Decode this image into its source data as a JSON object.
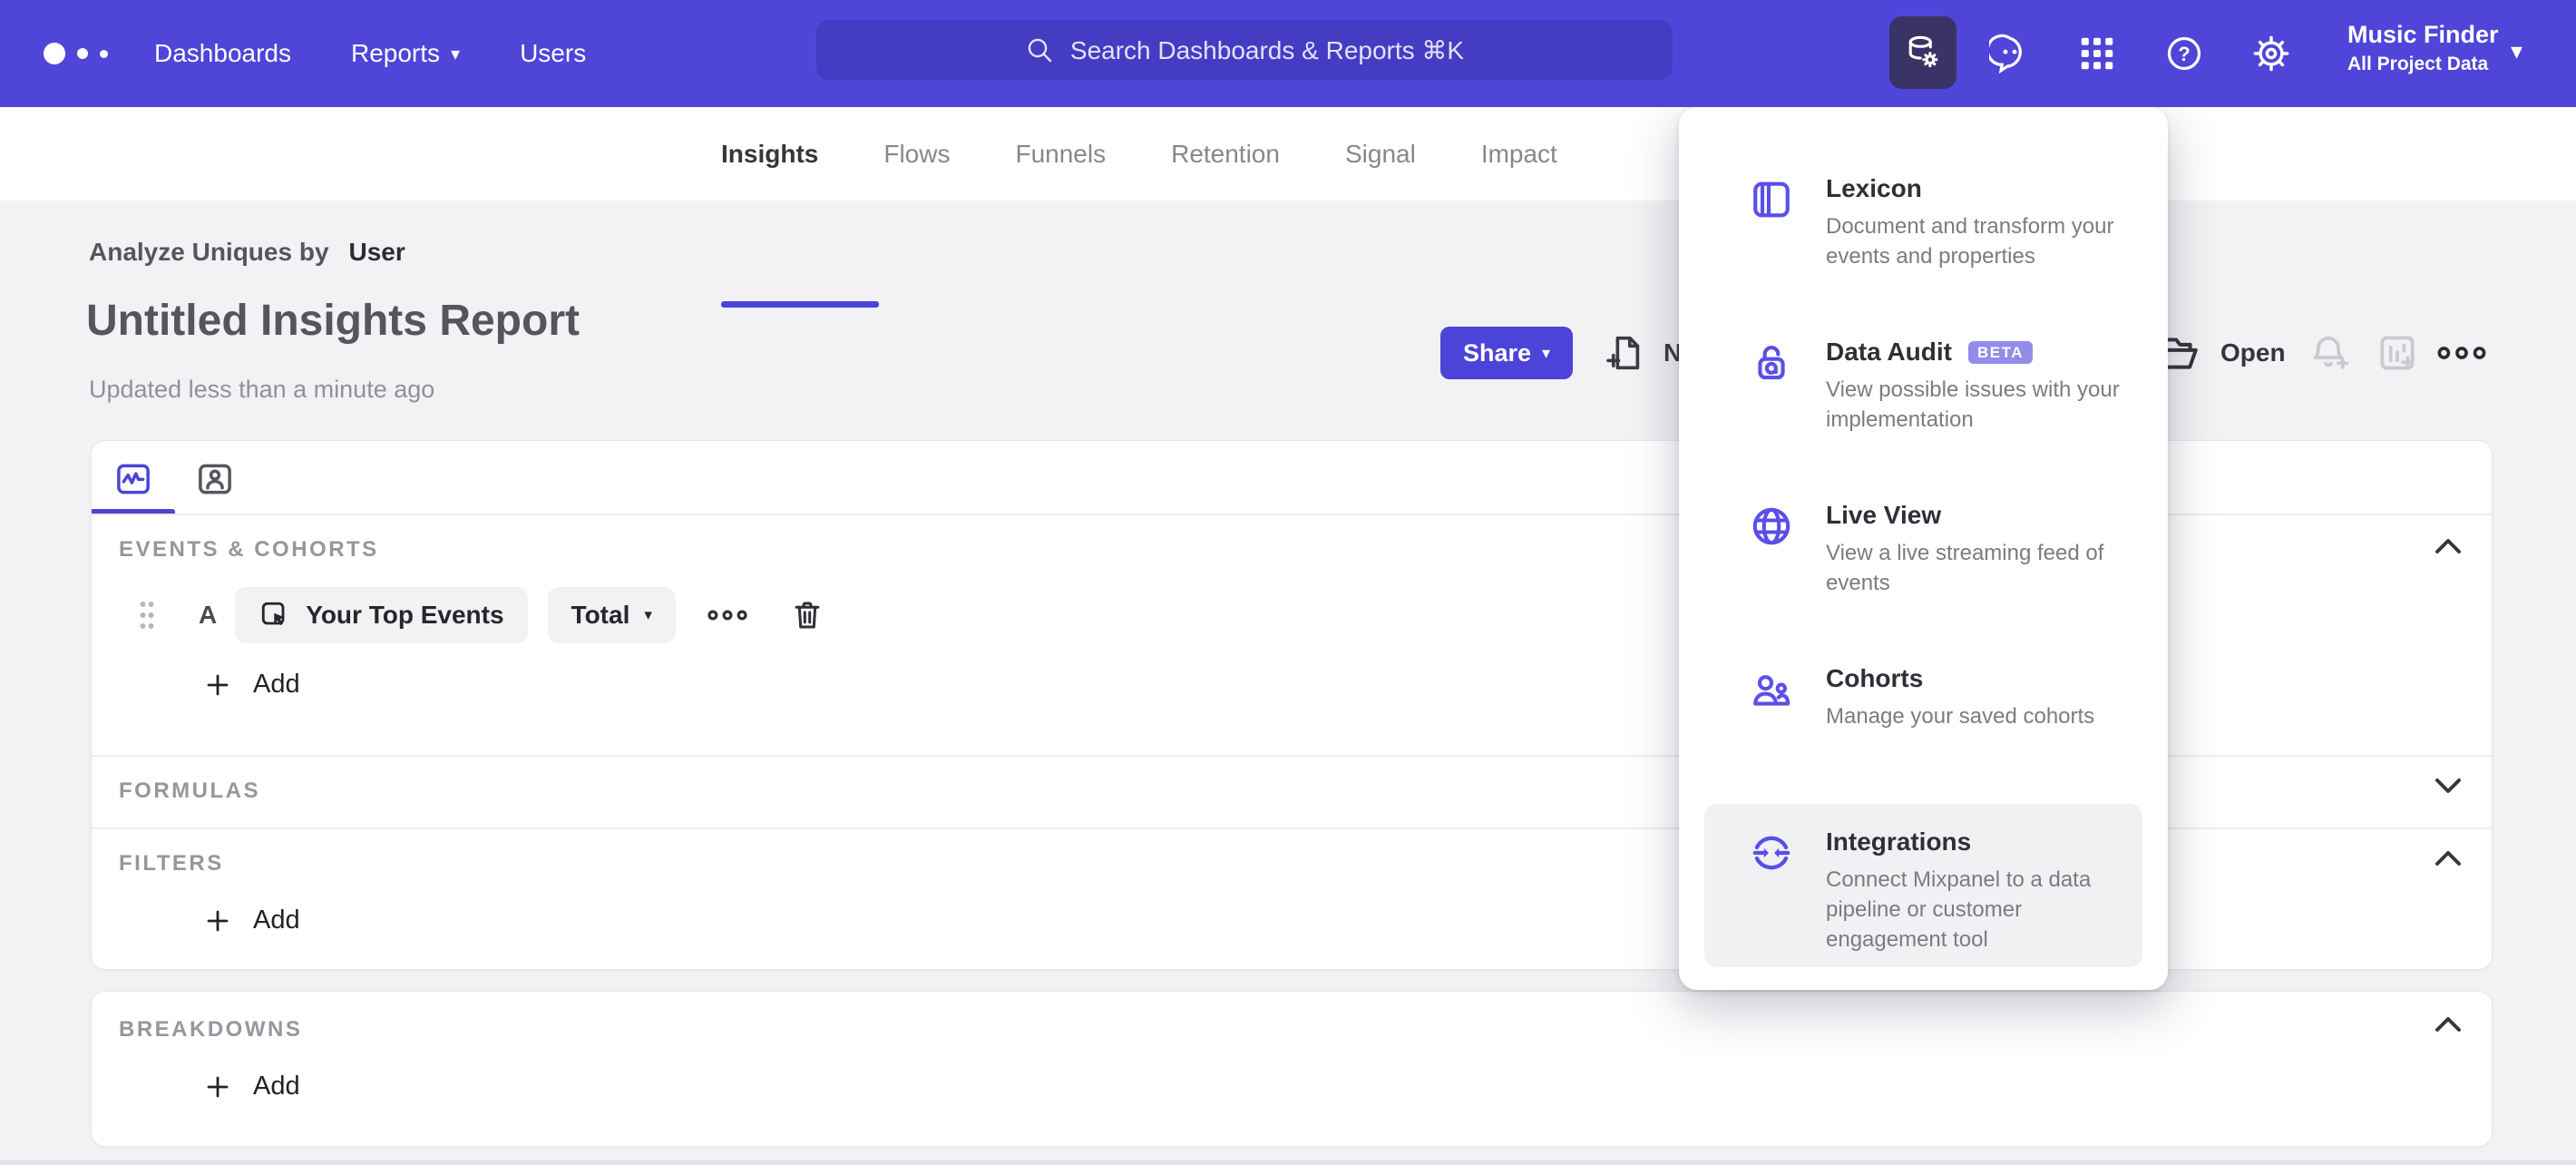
{
  "colors": {
    "navbar_bg": "#4f45d8",
    "search_bg": "#453cc4",
    "active_tool_bg": "#393366",
    "accent": "#4c43d8",
    "panel_icon": "#5a4fe8",
    "beta_badge_bg": "#938be9",
    "page_bg": "#f2f2f4"
  },
  "navbar": {
    "items": [
      {
        "label": "Dashboards"
      },
      {
        "label": "Reports"
      },
      {
        "label": "Users"
      }
    ],
    "search": {
      "placeholder": "Search Dashboards & Reports ⌘K"
    },
    "project": {
      "name": "Music Finder",
      "scope": "All Project Data"
    }
  },
  "report_tabs": {
    "active": "Insights",
    "items": [
      {
        "label": "Insights"
      },
      {
        "label": "Flows"
      },
      {
        "label": "Funnels"
      },
      {
        "label": "Retention"
      },
      {
        "label": "Signal"
      },
      {
        "label": "Impact"
      }
    ]
  },
  "header": {
    "analyze_prefix": "Analyze Uniques by",
    "analyze_entity": "User",
    "title": "Untitled Insights Report",
    "updated": "Updated less than a minute ago",
    "share_label": "Share",
    "new_report_label": "New Report",
    "open_label": "Open"
  },
  "data_menu": {
    "items": [
      {
        "title": "Lexicon",
        "desc": "Document and transform your events and properties"
      },
      {
        "title": "Data Audit",
        "badge": "BETA",
        "desc": "View possible issues with your implementation"
      },
      {
        "title": "Live View",
        "desc": "View a live streaming feed of events"
      },
      {
        "title": "Cohorts",
        "desc": "Manage your saved cohorts"
      },
      {
        "title": "Integrations",
        "desc": "Connect Mixpanel to a data pipeline or customer engagement tool"
      }
    ]
  },
  "builder": {
    "sections": [
      {
        "label": "EVENTS & COHORTS",
        "chevron": "up"
      },
      {
        "label": "FORMULAS",
        "chevron": "down"
      },
      {
        "label": "FILTERS",
        "chevron": "up"
      },
      {
        "label": "BREAKDOWNS",
        "chevron": "up"
      }
    ],
    "event_row": {
      "letter": "A",
      "event": "Your Top Events",
      "metric": "Total"
    },
    "add_label": "Add"
  }
}
